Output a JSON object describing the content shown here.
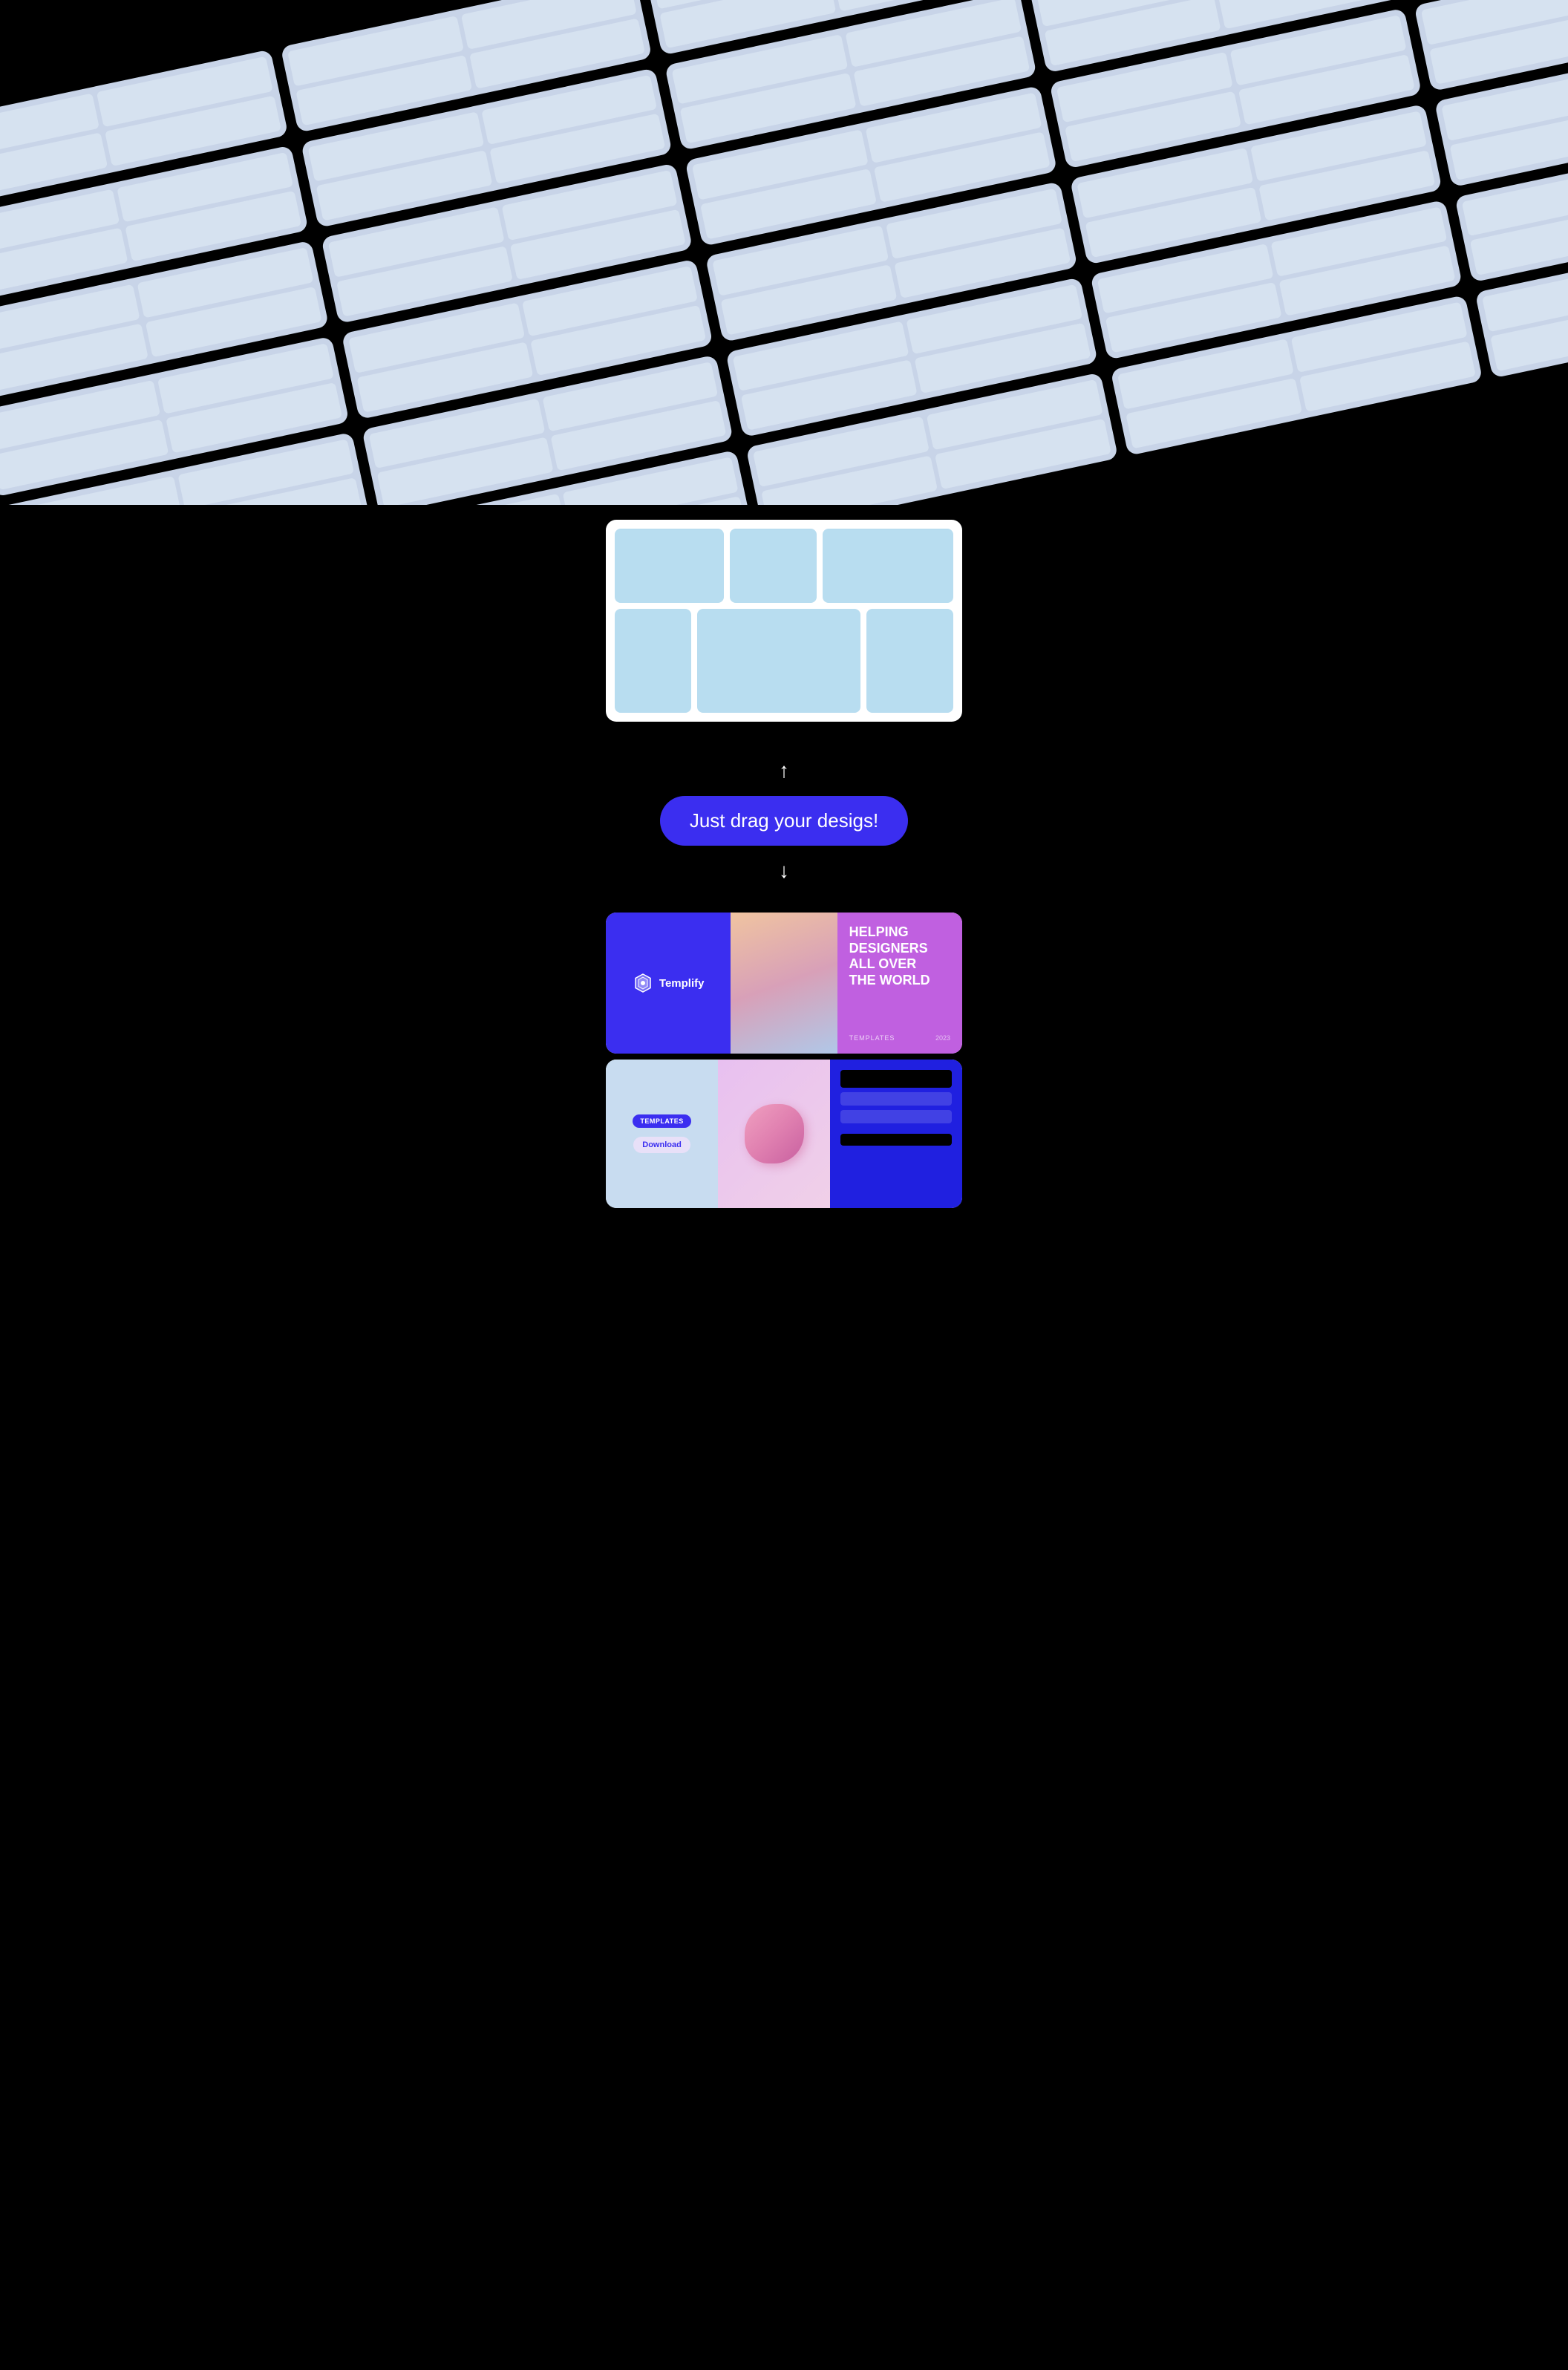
{
  "hero": {
    "grid_cells": 30,
    "background_color": "#000000",
    "cell_color": "#c8d4e8",
    "sub_cell_color": "#d6e2f0"
  },
  "drag_section": {
    "arrow_up": "↑",
    "drag_label": "Just drag your desigs!",
    "arrow_down": "↓",
    "blank_card_bg": "#b8ddf0"
  },
  "result_section": {
    "top_card": {
      "blue_cell_logo_name": "Templify",
      "photo_cell_type": "gradient",
      "text_cell_heading_line1": "HELPING",
      "text_cell_heading_line2": "DESIGNERS",
      "text_cell_heading_line3": "ALL OVER",
      "text_cell_heading_line4": "THE WORLD",
      "templates_label": "TEMPLATES",
      "year_label": "2023"
    },
    "bottom_card": {
      "badge_label": "Templates",
      "download_label": "Download",
      "object_type": "3d-shape"
    }
  }
}
